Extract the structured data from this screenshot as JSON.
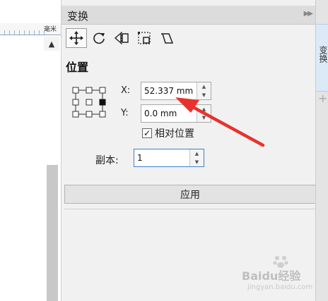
{
  "ruler": {
    "unit": "毫米"
  },
  "panel": {
    "title": "变换",
    "tools": [
      {
        "name": "position-tool",
        "icon": "move-cross-icon",
        "active": true
      },
      {
        "name": "rotate-tool",
        "icon": "rotate-icon",
        "active": false
      },
      {
        "name": "scale-mirror-tool",
        "icon": "mirror-icon",
        "active": false
      },
      {
        "name": "size-tool",
        "icon": "size-box-icon",
        "active": false
      },
      {
        "name": "skew-tool",
        "icon": "skew-icon",
        "active": false
      }
    ],
    "section_title": "位置",
    "x_label": "X:",
    "x_value": "52.337 mm",
    "y_label": "Y:",
    "y_value": "0.0 mm",
    "relative_position_label": "相对位置",
    "relative_position_checked": true,
    "copies_label": "副本:",
    "copies_value": "1",
    "apply_label": "应用"
  },
  "side_tab": {
    "label": "变换"
  },
  "watermark": {
    "text": "Baidu经验",
    "sub": "jingyan.baidu.com"
  },
  "colors": {
    "arrow": "#e8322d",
    "focus_border": "#3c7fc9"
  }
}
